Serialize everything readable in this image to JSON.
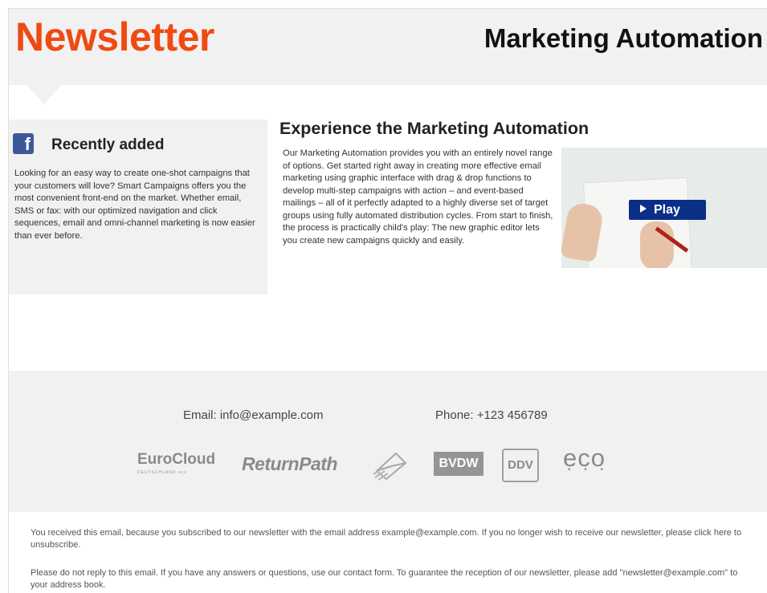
{
  "header": {
    "brand": "Newsletter",
    "title": "Marketing Automation"
  },
  "sidebar": {
    "icon": "facebook-icon",
    "icon_glyph": "f",
    "title": "Recently added",
    "text": "Looking for an easy way to create one-shot campaigns that your customers will love? Smart Campaigns offers you the most convenient front-end on the market. Whether email, SMS or fax: with our optimized navigation and click sequences, email and omni-channel marketing is now easier than ever before."
  },
  "main": {
    "title": "Experience the Marketing Automation",
    "text": "Our Marketing Automation provides you with an entirely novel range of options. Get started right away in creating more effective email marketing using graphic interface with drag & drop functions to develop multi-step campaigns with action – and event-based mailings – all of it perfectly adapted to a highly diverse set of target groups using fully automated distribution cycles. From start to finish, the process is practically child's play: The new graphic editor lets you create new campaigns quickly and easily.",
    "video": {
      "play_label": "Play"
    }
  },
  "footer": {
    "email": "Email: info@example.com",
    "phone": "Phone: +123 456789",
    "logos": {
      "eurocloud": "EuroCloud",
      "eurocloud_sub": "DEUTSCHLAND eco",
      "returnpath": "ReturnPath",
      "bvdw": "BVDW",
      "ddv": "DDV",
      "eco": "eco",
      "eco_dots": "• • •"
    }
  },
  "legal": {
    "line1": "You received this email, because you subscribed to our newsletter with the email address example@example.com. If you no longer wish to receive our newsletter, please click here to unsubscribe.",
    "line2": "Please do not reply to this email. If you have any answers or questions, use our contact form. To guarantee the reception of our newsletter, please add \"newsletter@example.com\" to your address book."
  },
  "colors": {
    "brand": "#f04a13",
    "panel": "#f1f1f1",
    "play_button": "#0b2f86",
    "facebook": "#3b5998"
  }
}
